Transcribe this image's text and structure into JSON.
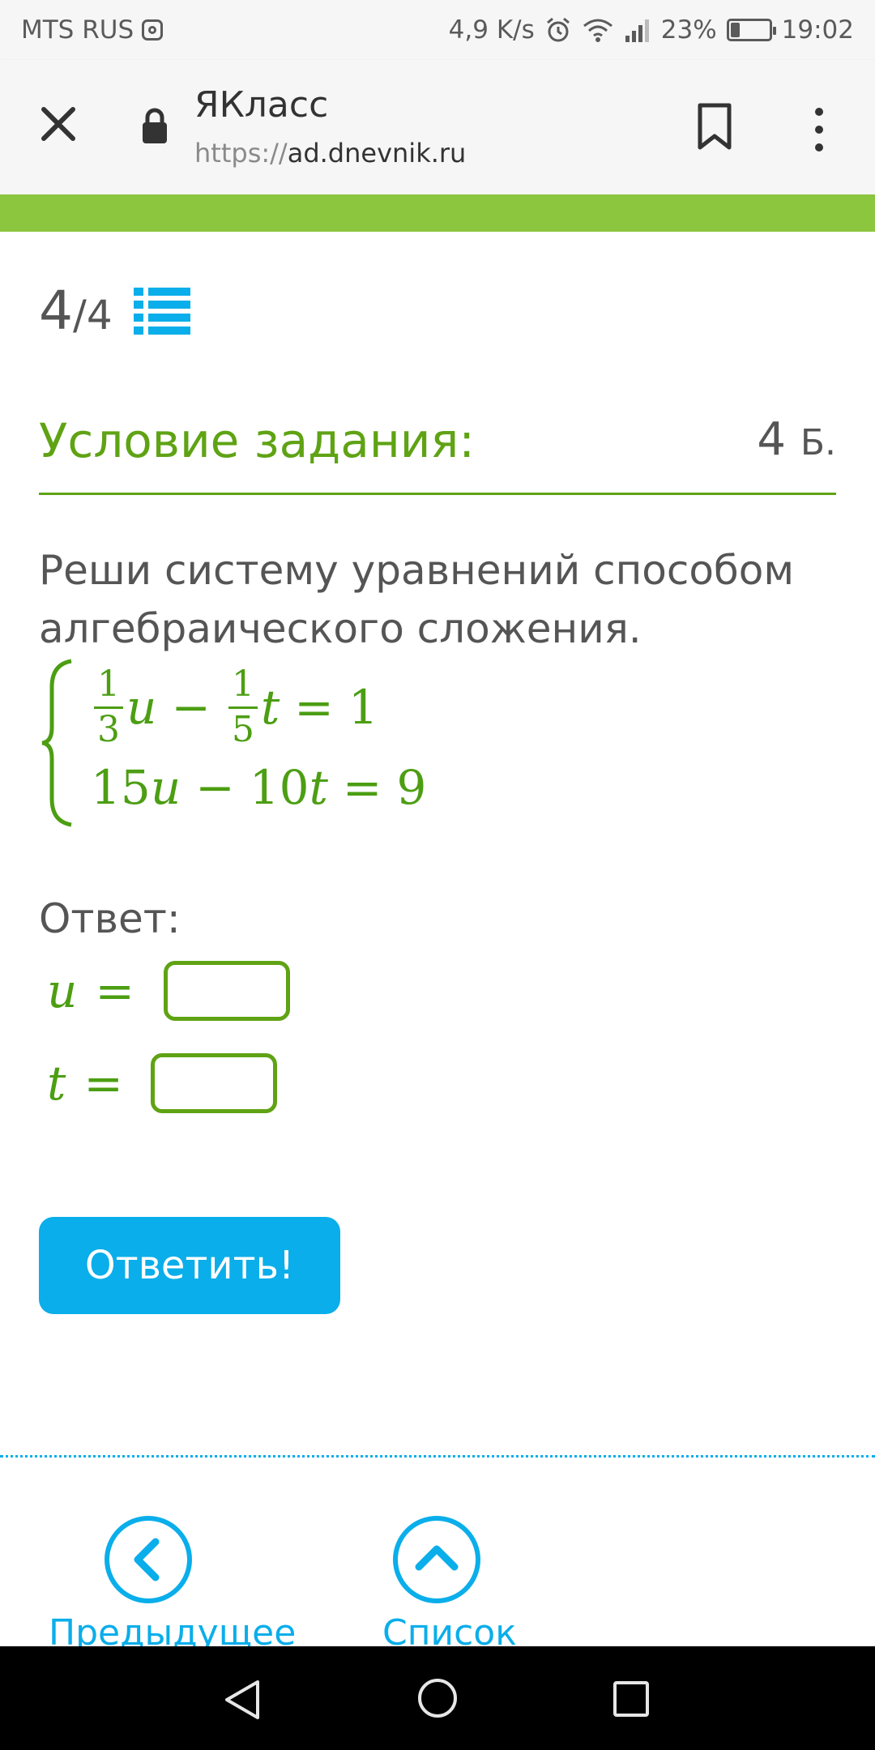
{
  "status_bar": {
    "carrier": "MTS RUS",
    "speed": "4,9 K/s",
    "battery_percent": "23%",
    "battery_level": 0.23,
    "time": "19:02"
  },
  "browser": {
    "site_name": "ЯКласс",
    "url_scheme": "https://",
    "url_host": "ad.dnevnik.ru"
  },
  "pager": {
    "current": "4",
    "separator": "/",
    "total": "4"
  },
  "task": {
    "title": "Условие задания:",
    "points_value": "4",
    "points_unit": "Б.",
    "text": "Реши систему уравнений способом алгебраического сложения."
  },
  "system": {
    "eq1": {
      "frac1_num": "1",
      "frac1_den": "3",
      "var1": "u",
      "op1": "−",
      "frac2_num": "1",
      "frac2_den": "5",
      "var2": "t",
      "eq_sign": "=",
      "rhs": "1"
    },
    "eq2": {
      "coef1": "15",
      "var1": "u",
      "op1": "−",
      "coef2": "10",
      "var2": "t",
      "eq_sign": "=",
      "rhs": "9"
    }
  },
  "answer": {
    "label": "Ответ:",
    "u_var": "u",
    "u_eq": "=",
    "u_value": "",
    "t_var": "t",
    "t_eq": "=",
    "t_value": ""
  },
  "submit_label": "Ответить!",
  "footer_nav": {
    "prev_label": "Предыдущее",
    "list_label": "Список"
  },
  "colors": {
    "accent_green": "#5fa314",
    "strip_green": "#8cc63f",
    "accent_blue": "#0aaeea"
  }
}
